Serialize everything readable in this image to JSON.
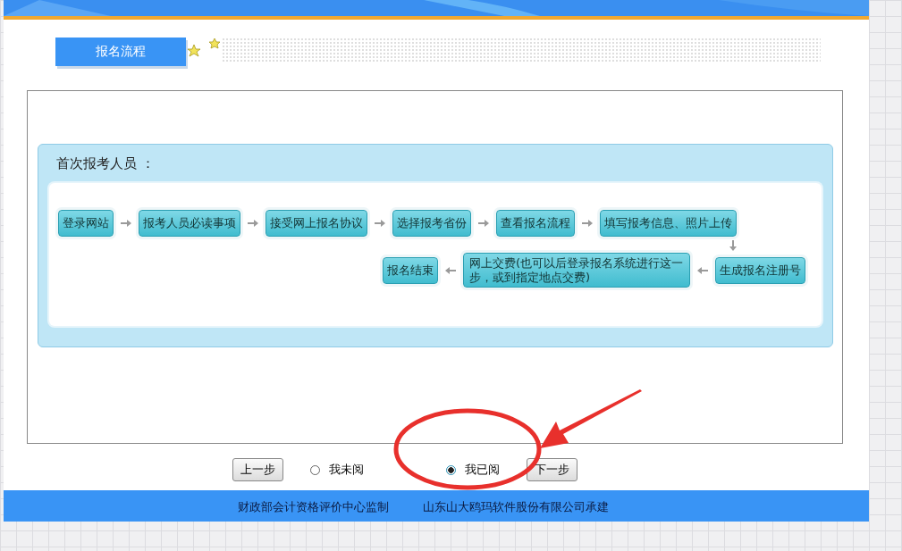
{
  "tab": {
    "label": "报名流程"
  },
  "flow": {
    "title": "首次报考人员 ：",
    "row_1": [
      "登录网站",
      "报考人员必读事项",
      "接受网上报名协议",
      "选择报考省份",
      "查看报名流程",
      "填写报考信息、照片上传"
    ],
    "row_2": [
      "报名结束",
      "网上交费(也可以后登录报名系统进行这一步，或到指定地点交费)",
      "生成报名注册号"
    ]
  },
  "prev_button": "上一步",
  "read_options": [
    {
      "label": "我未阅",
      "selected": false
    },
    {
      "label": "我已阅",
      "selected": true
    }
  ],
  "next_button": "下一步",
  "footer": [
    "财政部会计资格评价中心监制",
    "山东山大鸥玛软件股份有限公司承建"
  ]
}
